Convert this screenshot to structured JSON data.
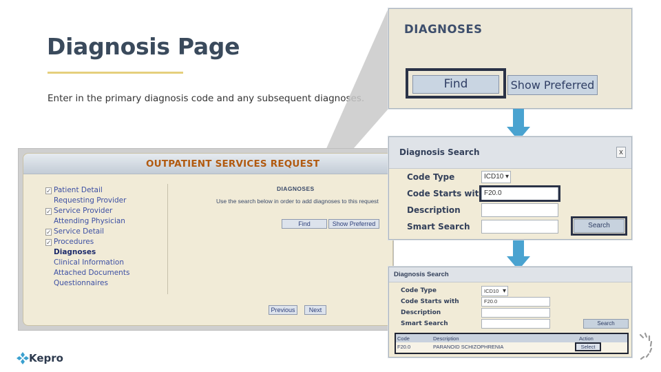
{
  "slide": {
    "title": "Diagnosis Page",
    "subtitle": "Enter in the primary diagnosis code and any subsequent diagnoses."
  },
  "outpatient": {
    "title": "OUTPATIENT SERVICES REQUEST",
    "nav_items": [
      {
        "label": "Patient Detail",
        "checked": true
      },
      {
        "label": "Requesting Provider",
        "checked": false
      },
      {
        "label": "Service Provider",
        "checked": true
      },
      {
        "label": "Attending Physician",
        "checked": false
      },
      {
        "label": "Service Detail",
        "checked": true
      },
      {
        "label": "Procedures",
        "checked": true
      },
      {
        "label": "Diagnoses",
        "checked": false,
        "active": true
      },
      {
        "label": "Clinical Information",
        "checked": false
      },
      {
        "label": "Attached Documents",
        "checked": false
      },
      {
        "label": "Questionnaires",
        "checked": false
      }
    ],
    "diagnoses_heading": "DIAGNOSES",
    "instruction": "Use the search below in order to add diagnoses to this request",
    "find_label": "Find",
    "show_preferred_label": "Show Preferred",
    "previous_label": "Previous",
    "next_label": "Next"
  },
  "zoom_panel": {
    "heading": "DIAGNOSES",
    "find_label": "Find",
    "show_preferred_label": "Show Preferred"
  },
  "search_panel": {
    "title": "Diagnosis Search",
    "close_symbol": "x",
    "code_type_label": "Code Type",
    "code_type_value": "ICD10",
    "code_starts_label": "Code Starts with",
    "code_starts_value": "F20.0",
    "description_label": "Description",
    "description_value": "",
    "smart_search_label": "Smart Search",
    "smart_search_value": "",
    "search_label": "Search"
  },
  "results_panel": {
    "title": "Diagnosis Search",
    "code_type_label": "Code Type",
    "code_type_value": "ICD10",
    "code_starts_label": "Code Starts with",
    "code_starts_value": "F20.0",
    "description_label": "Description",
    "smart_search_label": "Smart Search",
    "search_label": "Search",
    "columns": {
      "code": "Code",
      "description": "Description",
      "action": "Action"
    },
    "row": {
      "code": "F20.0",
      "description": "PARANOID SCHIZOPHRENIA",
      "action": "Select"
    }
  },
  "brand": {
    "name": "Kepro"
  },
  "colors": {
    "title": "#3a4a5c",
    "accent_rule": "#e5cf7c",
    "flow_arrow": "#4aa3d0",
    "logo": "#3aa0cf",
    "highlight_border": "#2a3247"
  }
}
